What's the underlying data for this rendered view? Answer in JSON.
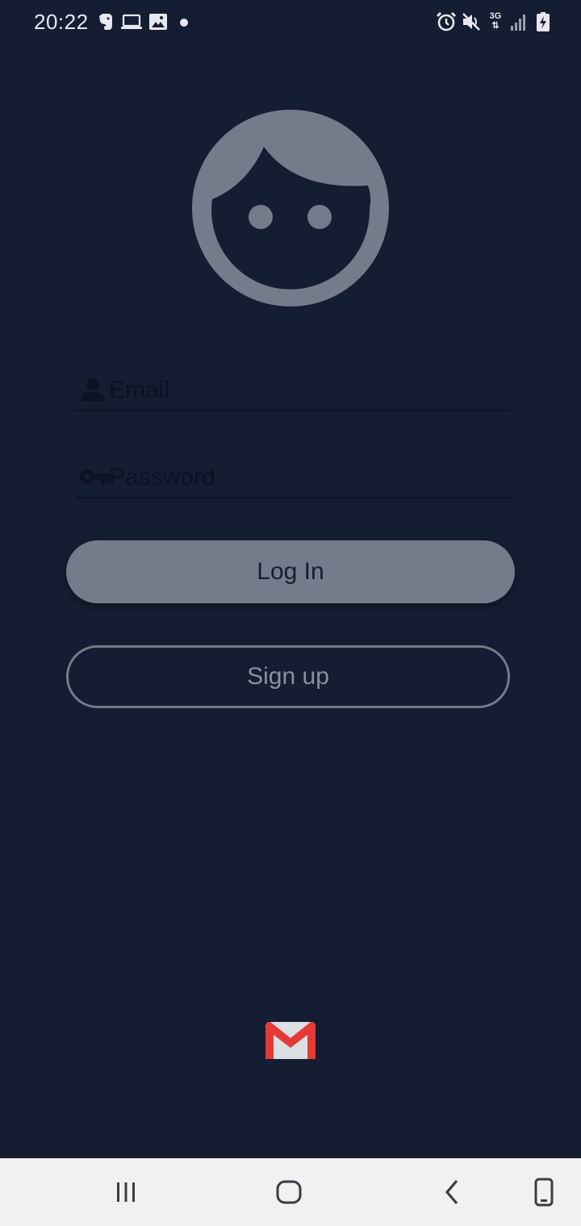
{
  "status_bar": {
    "time": "20:22",
    "network_type": "3G",
    "icons": [
      "evernote-icon",
      "laptop-icon",
      "image-icon",
      "notification-dot",
      "alarm-icon",
      "mute-icon",
      "network-3g-icon",
      "signal-icon",
      "battery-charging-icon"
    ]
  },
  "avatar": {
    "icon": "face-icon"
  },
  "login_form": {
    "email": {
      "icon": "person-icon",
      "placeholder": "Email",
      "value": ""
    },
    "password": {
      "icon": "key-icon",
      "placeholder": "Password",
      "value": ""
    },
    "login_label": "Log In",
    "signup_label": "Sign up"
  },
  "footer": {
    "icon": "gmail-icon"
  },
  "nav_bar": {
    "buttons": [
      "recent-apps-icon",
      "home-icon",
      "back-icon",
      "rotate-icon"
    ]
  },
  "colors": {
    "background": "#141d31",
    "accent": "#757b8a",
    "nav_background": "#f1f1f1"
  }
}
